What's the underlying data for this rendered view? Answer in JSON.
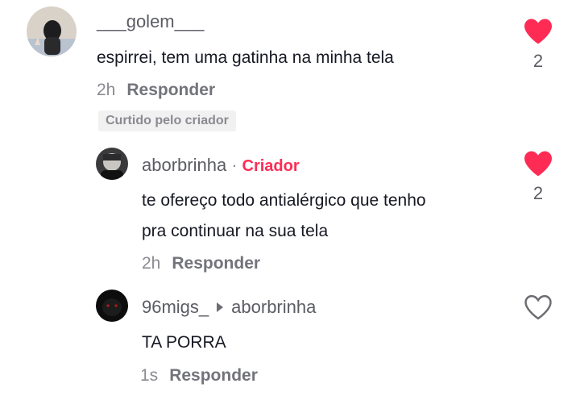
{
  "comments": [
    {
      "username": "___golem___",
      "text": "espirrei, tem uma gatinha na minha tela",
      "time": "2h",
      "reply_label": "Responder",
      "badge": "Curtido pelo criador",
      "likes": "2",
      "liked": true,
      "avatar_icon": "profile-photo"
    },
    {
      "username": "aborbrinha",
      "creator_tag": "Criador",
      "text_lines": [
        "te ofereço todo antialérgico que tenho",
        "pra continuar na sua tela"
      ],
      "time": "2h",
      "reply_label": "Responder",
      "likes": "2",
      "liked": true,
      "avatar_icon": "profile-photo"
    },
    {
      "username": "96migs_",
      "reply_to": "aborbrinha",
      "text": "TA PORRA",
      "time": "1s",
      "reply_label": "Responder",
      "liked": false,
      "avatar_icon": "profile-photo"
    }
  ],
  "colors": {
    "heart": "#fe2c55",
    "creator": "#fe2c55",
    "text": "#161823",
    "muted": "#8a8b91"
  }
}
